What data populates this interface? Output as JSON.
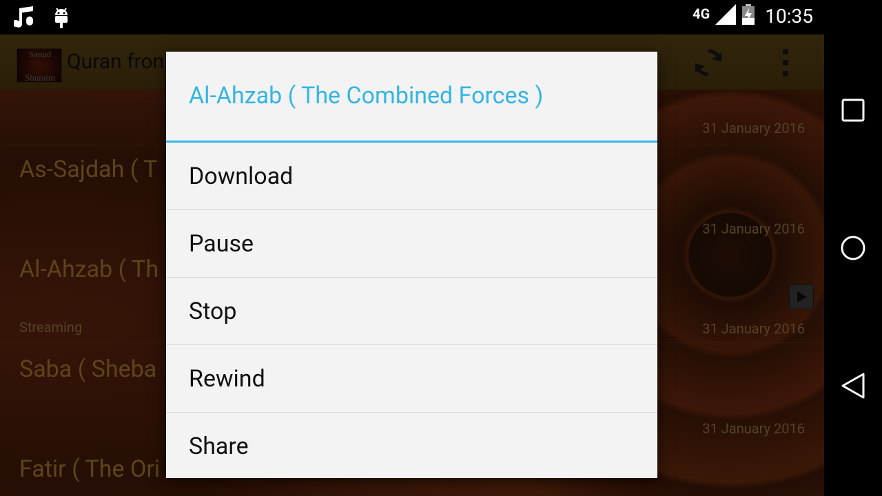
{
  "status_bar": {
    "network": "4G",
    "time": "10:35",
    "left_icons": [
      "music-note-icon",
      "android-debug-icon"
    ],
    "right_icons": [
      "signal-icon",
      "battery-charging-icon"
    ]
  },
  "app": {
    "title": "Quran fron",
    "logo_text_top": "Saoud",
    "logo_text_bottom": "Shuraim"
  },
  "list": [
    {
      "title": "As-Sajdah ( T",
      "date": "31 January 2016",
      "sub": ""
    },
    {
      "title": "Al-Ahzab ( Th",
      "date": "31 January 2016",
      "sub": "Streaming"
    },
    {
      "title": "Saba ( Sheba",
      "date": "31 January 2016",
      "sub": ""
    },
    {
      "title": "Fatir ( The Ori",
      "date": "31 January 2016",
      "sub": ""
    }
  ],
  "top_date": "31 January 2016",
  "dialog": {
    "title": "Al-Ahzab ( The Combined Forces )",
    "items": [
      "Download",
      "Pause",
      "Stop",
      "Rewind",
      "Share"
    ]
  },
  "colors": {
    "accent": "#33b5e5",
    "action_bar": "#b5892b",
    "dialog_bg": "#f3f3f3"
  }
}
